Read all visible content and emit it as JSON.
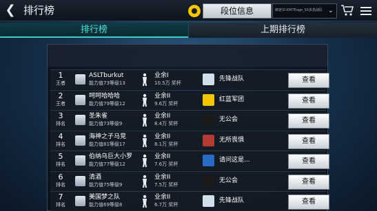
{
  "header": {
    "title": "排行榜",
    "rank_info_label": "段位信息",
    "account_text": "绑定ID:KMTEage_SS多态战队"
  },
  "tabs": [
    {
      "label": "排行榜",
      "active": true
    },
    {
      "label": "上期排行榜",
      "active": false
    }
  ],
  "colors": {
    "accent": "#3fd0c3",
    "panel": "#0a1018"
  },
  "rows": [
    {
      "rank": "1",
      "rank_label": "王者",
      "name": "ASLTburkut",
      "stats": "能力值73等级13",
      "division": "业余I",
      "cup": "10.5万 奖杯",
      "club": "先锋战队",
      "club_color": "#cfe0ea",
      "action": "查看"
    },
    {
      "rank": "2",
      "rank_label": "王者",
      "name": "呵呵哈哈哈",
      "stats": "能力值79等级12",
      "division": "业余II",
      "cup": "9.6万 奖杯",
      "club": "红蓝军团",
      "club_color": "#f2c500",
      "action": "查看"
    },
    {
      "rank": "3",
      "rank_label": "排名",
      "name": "圣朱雀",
      "stats": "能力值73等级9",
      "division": "业余II",
      "cup": "8.4万 奖杯",
      "club": "无公会",
      "club_color": "#1a1a1a",
      "action": "查看"
    },
    {
      "rank": "4",
      "rank_label": "排名",
      "name": "海神之子马竞",
      "stats": "能力值81等级17",
      "division": "业余II",
      "cup": "8.1万 奖杯",
      "club": "无所畏惧",
      "club_color": "#b33b34",
      "action": "查看"
    },
    {
      "rank": "5",
      "rank_label": "排名",
      "name": "伯纳乌巨大小罗",
      "stats": "能力值77等级12",
      "division": "业余II",
      "cup": "7.6万 奖杯",
      "club": "请问这是...",
      "club_color": "#2a6cc4",
      "action": "查看"
    },
    {
      "rank": "6",
      "rank_label": "排名",
      "name": "清酒",
      "stats": "能力值75等级9",
      "division": "业余II",
      "cup": "7.5万 奖杯",
      "club": "无公会",
      "club_color": "#1a1a1a",
      "action": "查看"
    },
    {
      "rank": "7",
      "rank_label": "排名",
      "name": "美国梦之队",
      "stats": "能力值69等级8",
      "division": "业余II",
      "cup": "6.7万 奖杯",
      "club": "先锋战队",
      "club_color": "#cfe0ea",
      "action": "查看"
    }
  ]
}
